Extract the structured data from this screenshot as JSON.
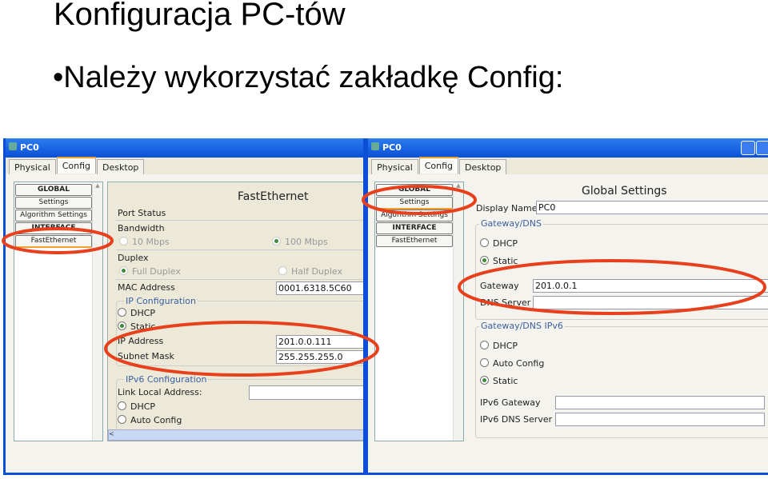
{
  "slide": {
    "title": "Konfiguracja PC-tów",
    "bullet": "•Należy wykorzystać zakładkę Config:"
  },
  "annotation_color": "#e8401c",
  "left_window": {
    "title": "PC0",
    "tabs": [
      "Physical",
      "Config",
      "Desktop"
    ],
    "active_tab": "Config",
    "list": [
      "GLOBAL",
      "Settings",
      "Algorithm Settings",
      "INTERFACE",
      "FastEthernet"
    ],
    "selected": "FastEthernet",
    "panel": {
      "heading": "FastEthernet",
      "port_status": "Port Status",
      "bandwidth": "Bandwidth",
      "bw_10": "10 Mbps",
      "bw_100": "100 Mbps",
      "duplex": "Duplex",
      "full": "Full Duplex",
      "half": "Half Duplex",
      "mac_label": "MAC Address",
      "mac_value": "0001.6318.5C60",
      "ip_config": "IP Configuration",
      "dhcp": "DHCP",
      "static": "Static",
      "ip_label": "IP Address",
      "ip_value": "201.0.0.111",
      "mask_label": "Subnet Mask",
      "mask_value": "255.255.255.0",
      "ipv6_config": "IPv6 Configuration",
      "link_local": "Link Local Address:",
      "link_local_value": "",
      "ipv6_dhcp": "DHCP",
      "ipv6_auto": "Auto Config"
    }
  },
  "right_window": {
    "title": "PC0",
    "tabs": [
      "Physical",
      "Config",
      "Desktop"
    ],
    "active_tab": "Config",
    "list": [
      "GLOBAL",
      "Settings",
      "Algorithm Settings",
      "INTERFACE",
      "FastEthernet"
    ],
    "selected": "Settings",
    "panel": {
      "heading": "Global Settings",
      "display_name_label": "Display Name",
      "display_name_value": "PC0",
      "gw_dns": "Gateway/DNS",
      "dhcp": "DHCP",
      "static": "Static",
      "gateway_label": "Gateway",
      "gateway_value": "201.0.0.1",
      "dns_label": "DNS Server",
      "dns_value": "",
      "gw_dns6": "Gateway/DNS IPv6",
      "dhcp6": "DHCP",
      "auto6": "Auto Config",
      "static6": "Static",
      "ipv6_gw_label": "IPv6 Gateway",
      "ipv6_gw_value": "",
      "ipv6_dns_label": "IPv6 DNS Server",
      "ipv6_dns_value": ""
    }
  }
}
